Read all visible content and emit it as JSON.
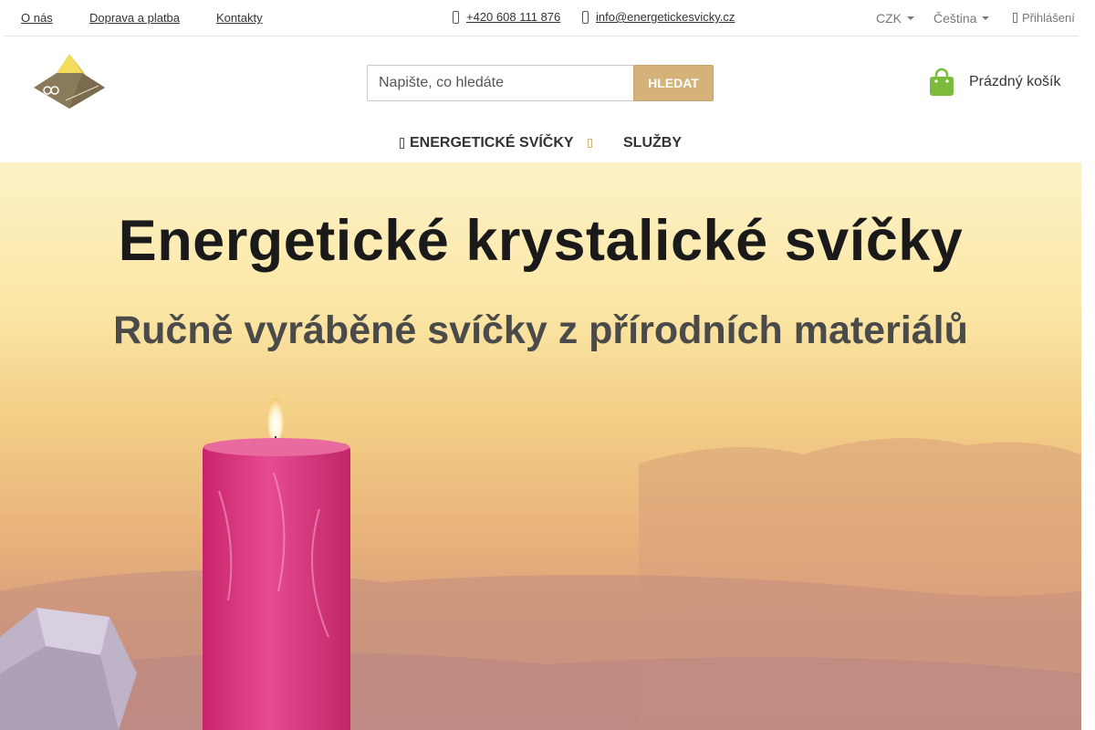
{
  "topbar": {
    "links": [
      "O nás",
      "Doprava a platba",
      "Kontakty"
    ],
    "phone": "+420 608 111 876",
    "email": "info@energetickesvicky.cz",
    "currency": "CZK",
    "language": "Čeština",
    "login": "Přihlášení"
  },
  "header": {
    "logo_icon": "pyramid-logo",
    "search_placeholder": "Napište, co hledáte",
    "search_button": "HLEDAT",
    "cart_icon": "shopping-bag-icon",
    "cart_label": "Prázdný košík"
  },
  "nav": {
    "items": [
      {
        "label": "ENERGETICKÉ SVÍČKY"
      },
      {
        "label": "SLUŽBY"
      }
    ]
  },
  "hero": {
    "title": "Energetické krystalické svíčky",
    "subtitle": "Ručně vyráběné svíčky z přírodních materiálů"
  },
  "colors": {
    "accent": "#d4b27a",
    "cart_green": "#7dbb3c",
    "candle_pink": "#de3f86"
  }
}
